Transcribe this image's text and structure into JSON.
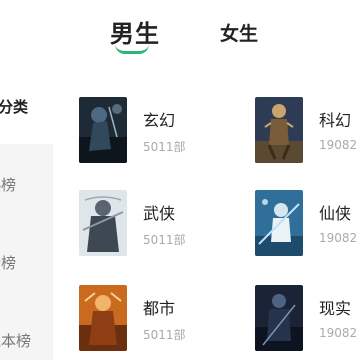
{
  "tabs": [
    {
      "label": "男生",
      "active": true
    },
    {
      "label": "女生",
      "active": false
    }
  ],
  "sidebar": {
    "header": "分类",
    "items": [
      {
        "label": "热榜"
      },
      {
        "label": "新榜"
      },
      {
        "label": "完本榜"
      }
    ]
  },
  "categories": [
    {
      "name": "玄幻",
      "count": "5011部",
      "cover_icon": "fantasy-cover"
    },
    {
      "name": "科幻",
      "count": "19082",
      "cover_icon": "scifi-cover"
    },
    {
      "name": "武侠",
      "count": "5011部",
      "cover_icon": "wuxia-cover"
    },
    {
      "name": "仙侠",
      "count": "19082",
      "cover_icon": "xianxia-cover"
    },
    {
      "name": "都市",
      "count": "5011部",
      "cover_icon": "urban-cover"
    },
    {
      "name": "现实",
      "count": "19082",
      "cover_icon": "reality-cover"
    }
  ],
  "colors": {
    "accent": "#2bb673",
    "sidebar_bg": "#f5f5f5"
  }
}
